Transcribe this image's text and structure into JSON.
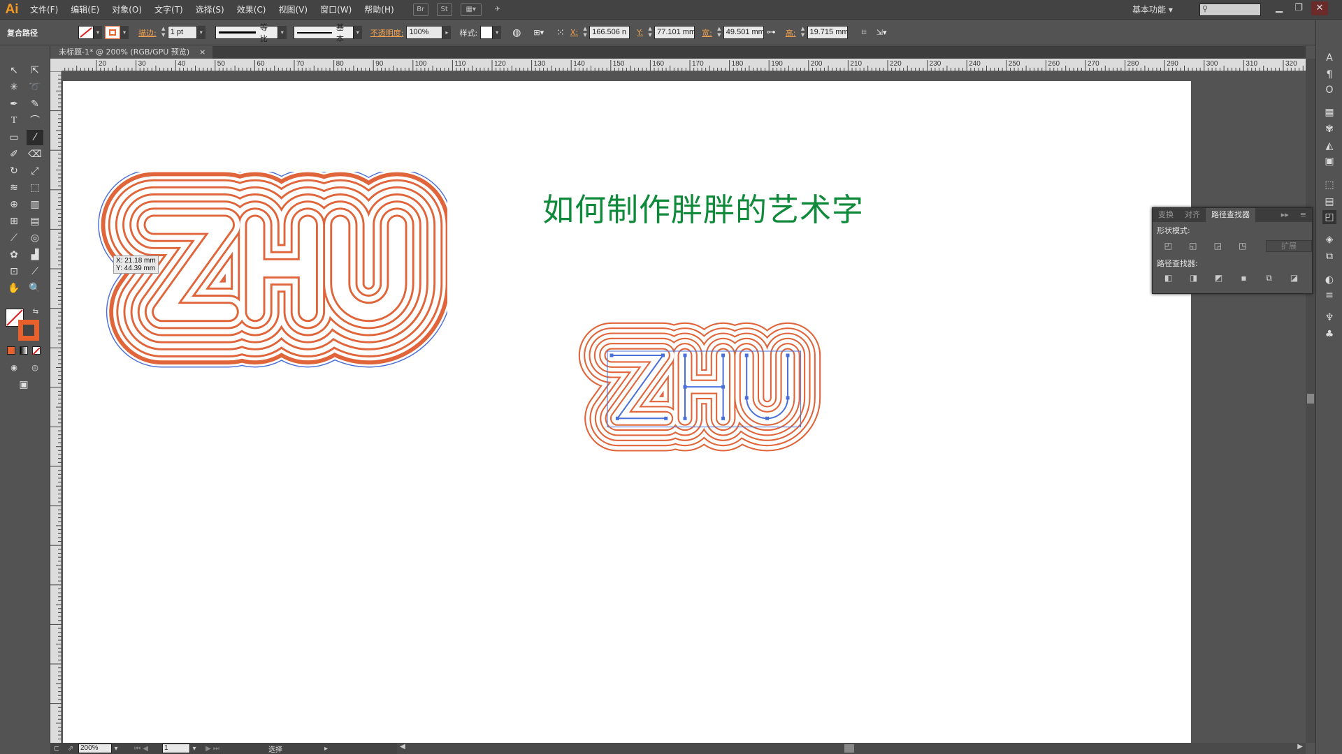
{
  "app": {
    "logo": "Ai"
  },
  "menu": [
    "文件(F)",
    "编辑(E)",
    "对象(O)",
    "文字(T)",
    "选择(S)",
    "效果(C)",
    "视图(V)",
    "窗口(W)",
    "帮助(H)"
  ],
  "menubar_icons": {
    "bridge": "Br",
    "stock": "St"
  },
  "workspace": "基本功能",
  "control": {
    "selection_type": "复合路径",
    "stroke_label": "描边:",
    "stroke_weight": "1 pt",
    "profile": "等比",
    "brush": "基本",
    "opacity_label": "不透明度:",
    "opacity": "100%",
    "style_label": "样式:",
    "x_label": "X:",
    "x": "166.506 n",
    "y_label": "Y:",
    "y": "77.101 mm",
    "w_label": "宽:",
    "w": "49.501 mm",
    "h_label": "高:",
    "h": "19.715 mm",
    "fill_color": "#ffffff",
    "stroke_color": "#e8602c"
  },
  "document": {
    "tab_title": "未标题-1* @ 200% (RGB/GPU 预览)",
    "close": "×"
  },
  "ruler": {
    "h_ticks": [
      "20",
      "30",
      "40",
      "50",
      "60",
      "70",
      "80",
      "90",
      "100",
      "110",
      "120",
      "130",
      "140",
      "150",
      "160",
      "170",
      "180",
      "190",
      "200",
      "210",
      "220",
      "230",
      "240",
      "250",
      "260",
      "270",
      "280",
      "290",
      "300",
      "310",
      "320"
    ]
  },
  "artboard": {
    "title": "如何制作胖胖的艺术字",
    "art_text": "ZHU",
    "outline_color": "#e0653a",
    "path_color": "#4a6fd8",
    "title_color": "#0f8a3b"
  },
  "tooltip": {
    "x": "X: 21.18 mm",
    "y": "Y: 44.39 mm"
  },
  "pathfinder": {
    "tabs": [
      "变换",
      "对齐",
      "路径查找器"
    ],
    "shape_modes_label": "形状模式:",
    "pathfinders_label": "路径查找器:",
    "expand": "扩展"
  },
  "status": {
    "zoom": "200%",
    "page": "1",
    "mode": "选择"
  }
}
